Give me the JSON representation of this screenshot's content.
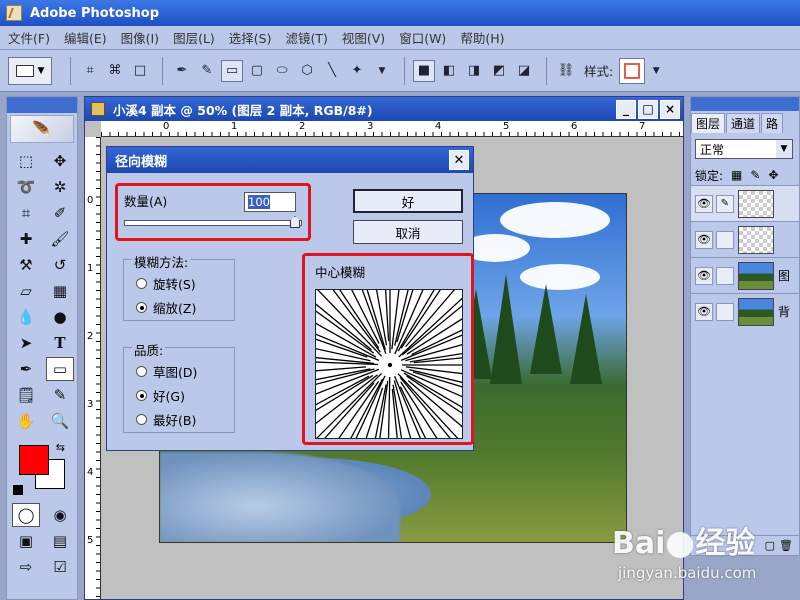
{
  "app": {
    "title": "Adobe Photoshop"
  },
  "menu": {
    "items": [
      "文件(F)",
      "编辑(E)",
      "图像(I)",
      "图层(L)",
      "选择(S)",
      "滤镜(T)",
      "视图(V)",
      "窗口(W)",
      "帮助(H)"
    ]
  },
  "options": {
    "style_label": "样式:"
  },
  "document": {
    "title": "小溪4 副本 @ 50% (图层 2 副本, RGB/8#)",
    "ruler_h": [
      "0",
      "1",
      "2",
      "3",
      "4",
      "5",
      "6",
      "7"
    ],
    "ruler_v": [
      "0",
      "1",
      "2",
      "3",
      "4",
      "5"
    ]
  },
  "dialog": {
    "title": "径向模糊",
    "amount_label": "数量(A)",
    "amount_value": "100",
    "ok_label": "好",
    "cancel_label": "取消",
    "method_title": "模糊方法:",
    "method_spin": "旋转(S)",
    "method_zoom": "缩放(Z)",
    "method_selected": "zoom",
    "quality_title": "品质:",
    "quality_draft": "草图(D)",
    "quality_good": "好(G)",
    "quality_best": "最好(B)",
    "quality_selected": "good",
    "center_label": "中心模糊"
  },
  "layers": {
    "tabs": [
      "图层",
      "通道",
      "路"
    ],
    "blend_mode": "正常",
    "lock_label": "锁定:",
    "rows": [
      {
        "name": "",
        "thumb": "transparent",
        "selected": true
      },
      {
        "name": "",
        "thumb": "transparent",
        "selected": false
      },
      {
        "name": "图",
        "thumb": "landscape",
        "selected": false
      },
      {
        "name": "背",
        "thumb": "landscape",
        "selected": false
      }
    ]
  },
  "watermark": {
    "brand_left": "Bai",
    "brand_right": "经验",
    "url": "jingyan.baidu.com"
  },
  "colors": {
    "foreground": "#ff0000",
    "background": "#ffffff",
    "highlight": "#e0141e"
  }
}
